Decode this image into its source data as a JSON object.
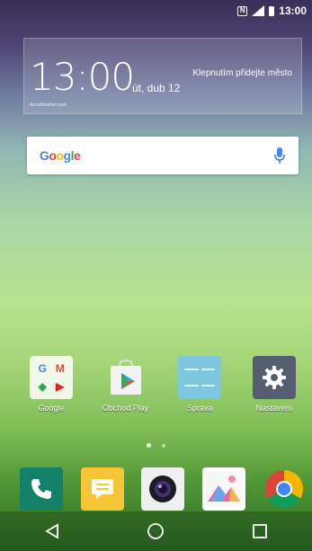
{
  "status_bar": {
    "time": "13:00",
    "icons": [
      "nfc-icon",
      "data-signal-icon",
      "battery-icon"
    ]
  },
  "weather": {
    "time": "13:00",
    "date": "út, dub 12",
    "location_prompt": "Klepnutím přidejte město",
    "provider": "AccuWeather.com"
  },
  "search": {
    "brand": "Google",
    "icon": "mic-icon",
    "accent": "#4285f4"
  },
  "apps": [
    {
      "label": "Google",
      "icon": "google-folder-icon"
    },
    {
      "label": "Obchod Play",
      "icon": "play-store-icon"
    },
    {
      "label": "Správa",
      "icon": "management-folder-icon"
    },
    {
      "label": "Nastavení",
      "icon": "gear-icon"
    }
  ],
  "pages": {
    "count": 2,
    "current": 1
  },
  "dock": [
    "phone-icon",
    "messages-icon",
    "camera-icon",
    "gallery-icon",
    "chrome-icon"
  ],
  "nav": [
    "back-icon",
    "home-icon",
    "recents-icon"
  ]
}
